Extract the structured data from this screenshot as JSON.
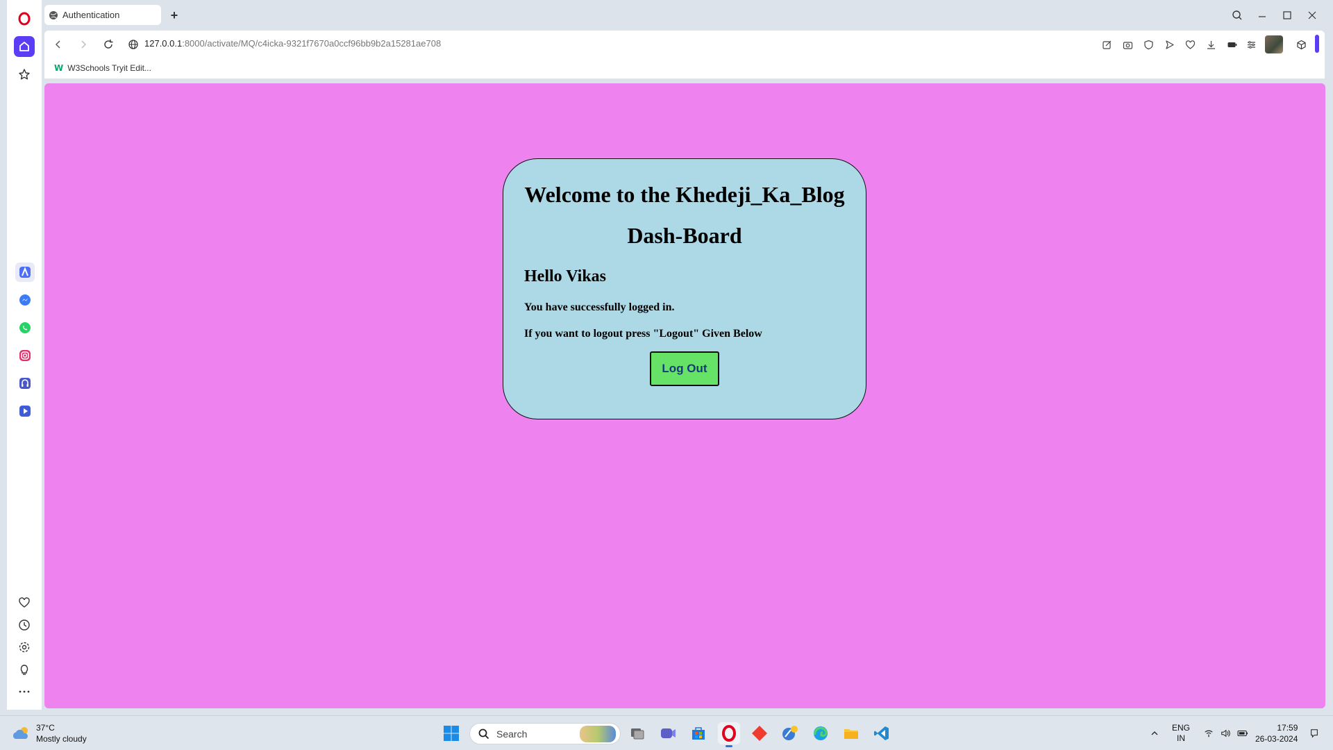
{
  "browser": {
    "tab_title": "Authentication",
    "new_tab_symbol": "+",
    "url_host": "127.0.0.1",
    "url_path": ":8000/activate/MQ/c4icka-9321f7670a0ccf96bb9b2a15281ae708",
    "bookmark_label": "W3Schools Tryit Edit...",
    "bookmark_favicon_text": "W",
    "accent_color": "#5b3df5"
  },
  "page": {
    "background_color": "#ee82ee",
    "card_color": "#add8e6",
    "heading": "Welcome to the Khedeji_Ka_Blog Dash-Board",
    "greeting": "Hello Vikas",
    "message_1": "You have successfully logged in.",
    "message_2": "If you want to logout press \"Logout\" Given Below",
    "logout_label": "Log Out",
    "logout_color": "#66e266"
  },
  "taskbar": {
    "weather_temp": "37°C",
    "weather_desc": "Mostly cloudy",
    "search_placeholder": "Search",
    "lang_top": "ENG",
    "lang_bottom": "IN",
    "time": "17:59",
    "date": "26-03-2024"
  }
}
